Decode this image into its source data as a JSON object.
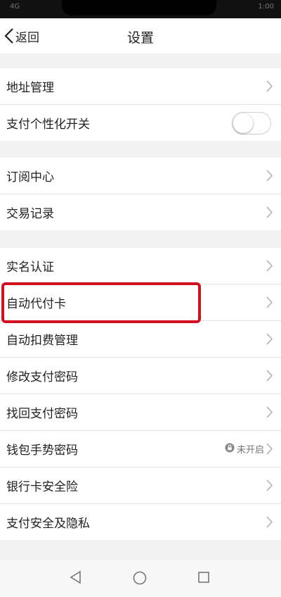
{
  "header": {
    "back_label": "返回",
    "title": "设置"
  },
  "status_bar": {
    "left_text": "4G",
    "time": "1:00"
  },
  "items": {
    "address": {
      "label": "地址管理"
    },
    "personalization": {
      "label": "支付个性化开关",
      "toggle_on": false
    },
    "subscription": {
      "label": "订阅中心"
    },
    "transactions": {
      "label": "交易记录"
    },
    "realname": {
      "label": "实名认证"
    },
    "auto_card": {
      "label": "自动代付卡"
    },
    "auto_deduct": {
      "label": "自动扣费管理"
    },
    "change_pwd": {
      "label": "修改支付密码"
    },
    "recover_pwd": {
      "label": "找回支付密码"
    },
    "gesture": {
      "label": "钱包手势密码",
      "status": "未开启"
    },
    "insurance": {
      "label": "银行卡安全险"
    },
    "privacy": {
      "label": "支付安全及隐私"
    }
  },
  "highlight_color": "#d0101e",
  "nav": {
    "back": "back-triangle-icon",
    "home": "home-circle-icon",
    "recent": "recent-square-icon"
  }
}
